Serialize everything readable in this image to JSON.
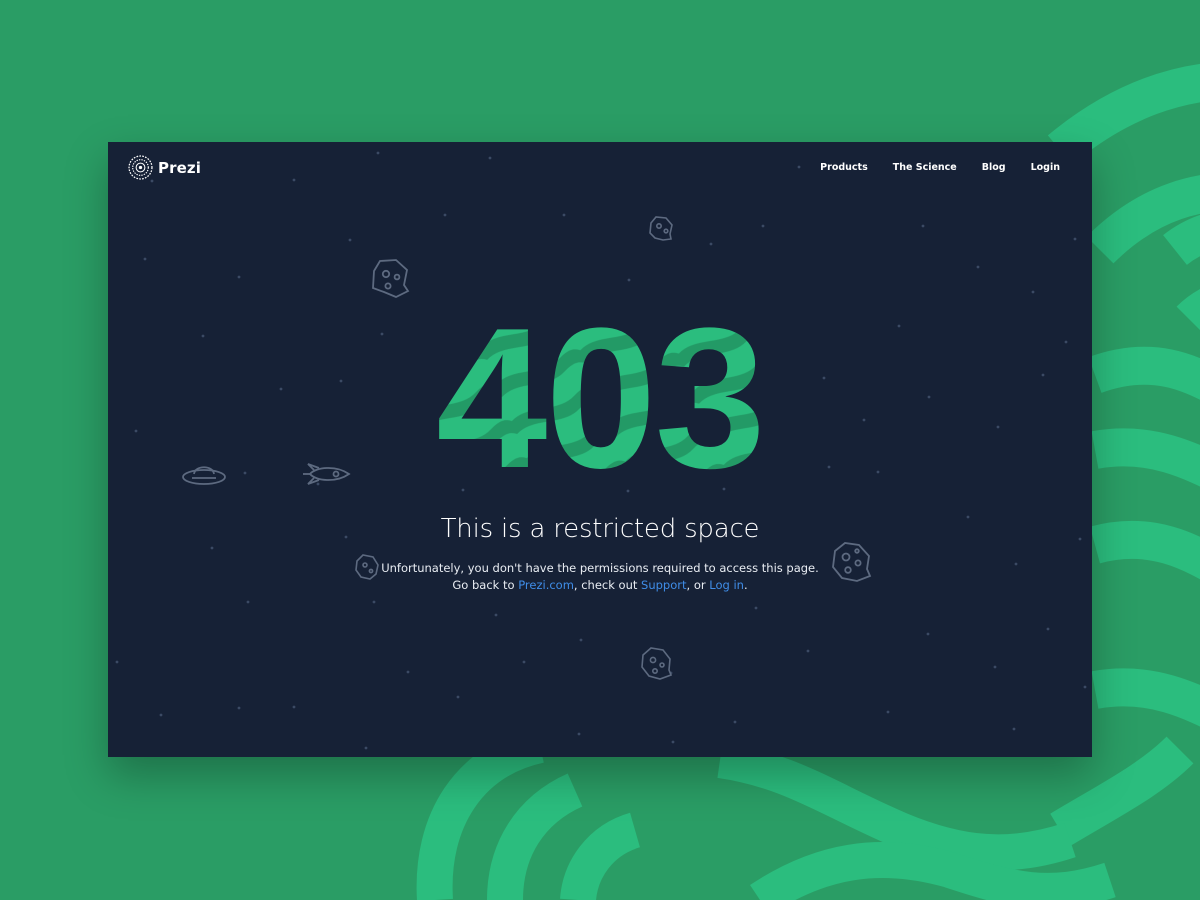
{
  "brand": {
    "name": "Prezi",
    "accent_green": "#2bbd7e",
    "deep_green": "#2a9d65",
    "panel_color": "#162136",
    "link_color": "#3f8de8"
  },
  "nav": {
    "items": [
      {
        "label": "Products"
      },
      {
        "label": "The Science"
      },
      {
        "label": "Blog"
      },
      {
        "label": "Login"
      }
    ]
  },
  "error": {
    "code": "403",
    "headline": "This is a restricted space",
    "line1": "Unfortunately, you don't have the permissions required to access this page.",
    "line2_prefix": "Go back to ",
    "link_home": "Prezi.com",
    "line2_mid1": ", check out ",
    "link_support": "Support",
    "line2_mid2": ", or ",
    "link_login": "Log in",
    "line2_suffix": "."
  },
  "decorations": {
    "icons": [
      "asteroid-icon",
      "ufo-icon",
      "rocket-icon",
      "star-dots"
    ]
  }
}
